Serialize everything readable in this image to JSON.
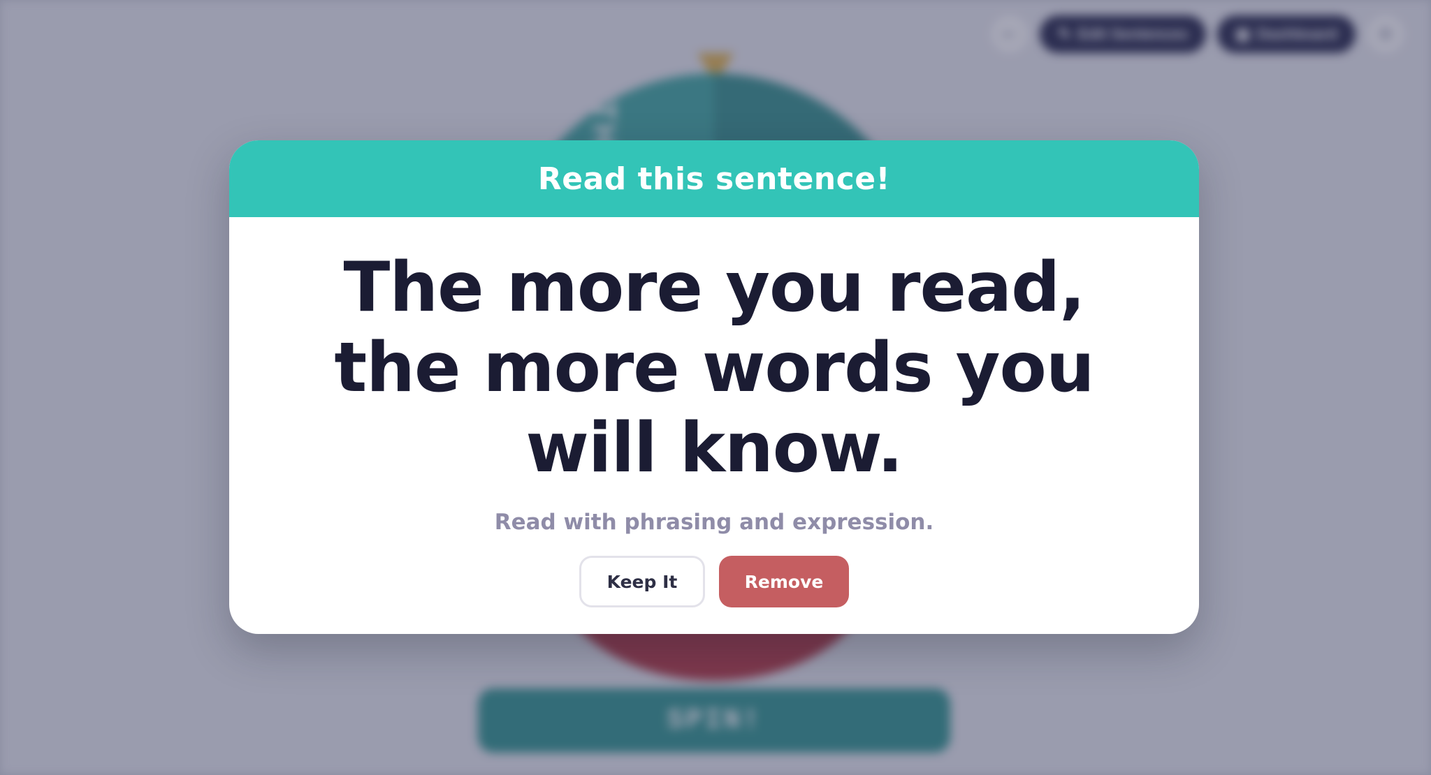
{
  "background": {
    "toolbar": {
      "back_icon": "arrow-left-icon",
      "edit_label": "Edit Sentences",
      "edit_icon": "pencil-icon",
      "dashboard_label": "Dashboard",
      "dashboard_icon": "grid-icon",
      "settings_icon": "gear-icon"
    },
    "wheel_text": "THE YA",
    "spin_label": "SPIN!"
  },
  "modal": {
    "title": "Read this sentence!",
    "sentence": "The more you read, the more words you will know.",
    "hint": "Read with phrasing and expression.",
    "keep_label": "Keep It",
    "remove_label": "Remove"
  },
  "colors": {
    "header": "#33c4b7",
    "sentence_text": "#1b1c33",
    "hint_text": "#8f8ca8",
    "remove_button": "#c55e61",
    "spin_button": "#2b938c"
  }
}
